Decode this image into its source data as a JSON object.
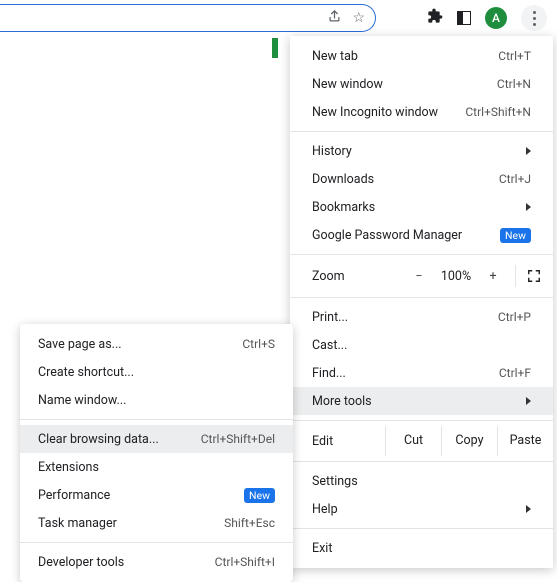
{
  "toolbar": {
    "avatar_letter": "A",
    "share_glyph": "⇪",
    "star_glyph": "☆",
    "puzzle_glyph": "✦"
  },
  "menu": {
    "new_tab": {
      "label": "New tab",
      "shortcut": "Ctrl+T"
    },
    "new_window": {
      "label": "New window",
      "shortcut": "Ctrl+N"
    },
    "new_incognito": {
      "label": "New Incognito window",
      "shortcut": "Ctrl+Shift+N"
    },
    "history": {
      "label": "History"
    },
    "downloads": {
      "label": "Downloads",
      "shortcut": "Ctrl+J"
    },
    "bookmarks": {
      "label": "Bookmarks"
    },
    "password_mgr": {
      "label": "Google Password Manager",
      "badge": "New"
    },
    "zoom": {
      "label": "Zoom",
      "minus": "−",
      "pct": "100%",
      "plus": "+"
    },
    "print": {
      "label": "Print...",
      "shortcut": "Ctrl+P"
    },
    "cast": {
      "label": "Cast..."
    },
    "find": {
      "label": "Find...",
      "shortcut": "Ctrl+F"
    },
    "more_tools": {
      "label": "More tools"
    },
    "edit": {
      "label": "Edit",
      "cut": "Cut",
      "copy": "Copy",
      "paste": "Paste"
    },
    "settings": {
      "label": "Settings"
    },
    "help": {
      "label": "Help"
    },
    "exit": {
      "label": "Exit"
    }
  },
  "submenu": {
    "save_page": {
      "label": "Save page as...",
      "shortcut": "Ctrl+S"
    },
    "create_shortcut": {
      "label": "Create shortcut..."
    },
    "name_window": {
      "label": "Name window..."
    },
    "clear_data": {
      "label": "Clear browsing data...",
      "shortcut": "Ctrl+Shift+Del"
    },
    "extensions": {
      "label": "Extensions"
    },
    "performance": {
      "label": "Performance",
      "badge": "New"
    },
    "task_manager": {
      "label": "Task manager",
      "shortcut": "Shift+Esc"
    },
    "developer_tools": {
      "label": "Developer tools",
      "shortcut": "Ctrl+Shift+I"
    }
  }
}
